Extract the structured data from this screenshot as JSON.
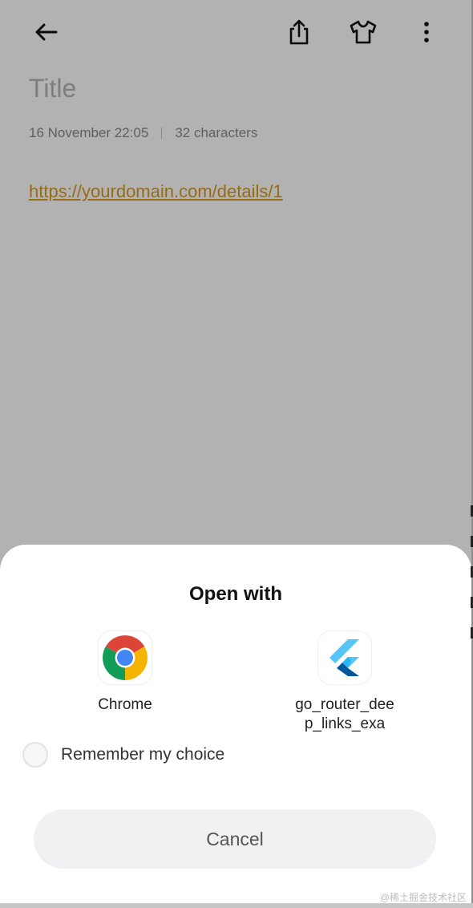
{
  "note": {
    "title": "Title",
    "date": "16 November  22:05",
    "char_count": "32 characters",
    "link": "https://yourdomain.com/details/1"
  },
  "toolbar": {
    "icons": [
      "back-arrow-icon",
      "share-icon",
      "theme-shirt-icon",
      "more-vert-icon"
    ]
  },
  "sheet": {
    "title": "Open with",
    "apps": [
      {
        "name": "Chrome",
        "icon": "chrome-icon"
      },
      {
        "name": "go_router_deep_links_exa",
        "icon": "flutter-icon"
      }
    ],
    "remember_label": "Remember my choice",
    "remember_checked": false,
    "cancel_label": "Cancel"
  },
  "watermark": "@稀土掘金技术社区",
  "colors": {
    "link": "#d79a1e",
    "overlay": "rgba(0,0,0,0.30)",
    "chrome_red": "#DB4437",
    "chrome_yellow": "#F4B400",
    "chrome_green": "#0F9D58",
    "chrome_blue": "#4285F4",
    "flutter_light": "#54C5F8",
    "flutter_dark": "#01579B"
  }
}
